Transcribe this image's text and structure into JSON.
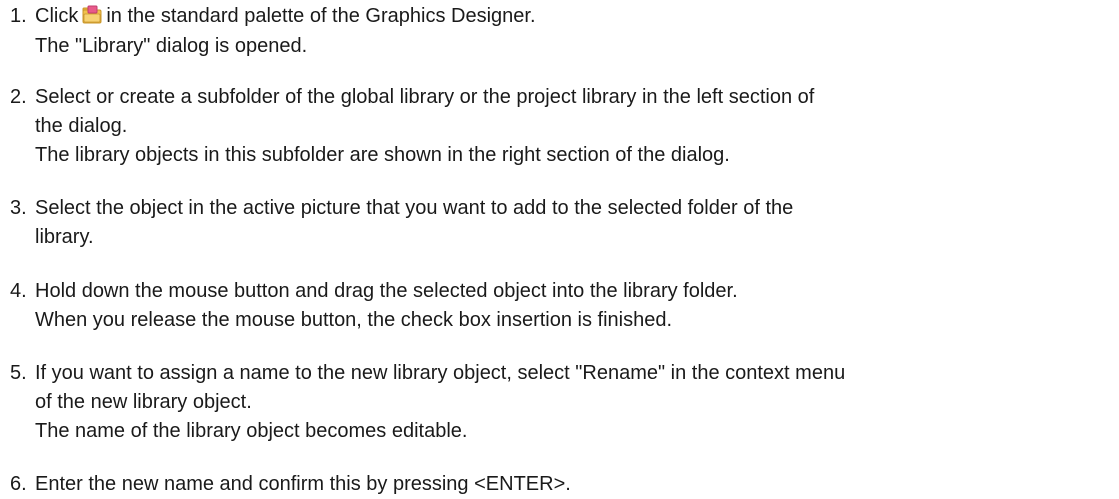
{
  "steps": [
    {
      "number": "1.",
      "lines": [
        {
          "before_icon": "Click",
          "icon": "library-icon",
          "after_icon": "in the standard palette of the Graphics Designer."
        },
        {
          "text": "The \"Library\" dialog is opened."
        }
      ]
    },
    {
      "number": "2.",
      "lines": [
        {
          "text": "Select or create a subfolder of the global library or the project library in the left section of"
        },
        {
          "text": "the dialog."
        },
        {
          "text": "The library objects in this subfolder are shown in the right section of the dialog."
        }
      ]
    },
    {
      "number": "3.",
      "lines": [
        {
          "text": "Select the object in the active picture that you want to add to the selected folder of the"
        },
        {
          "text": "library."
        }
      ]
    },
    {
      "number": "4.",
      "lines": [
        {
          "text": "Hold down the mouse button and drag the selected object into the library folder."
        },
        {
          "text": "When you release the mouse button, the check box insertion is finished."
        }
      ]
    },
    {
      "number": "5.",
      "lines": [
        {
          "text": "If you want to assign a name to the new library object, select \"Rename\" in the context menu"
        },
        {
          "text": "of the new library object."
        },
        {
          "text": "The name of the library object becomes editable."
        }
      ]
    },
    {
      "number": "6.",
      "lines": [
        {
          "text": "Enter the new name and confirm this by pressing <ENTER>."
        }
      ]
    }
  ],
  "colors": {
    "text": "#1a1a1a",
    "icon_folder": "#f2c14e",
    "icon_accent": "#e85a8a"
  }
}
